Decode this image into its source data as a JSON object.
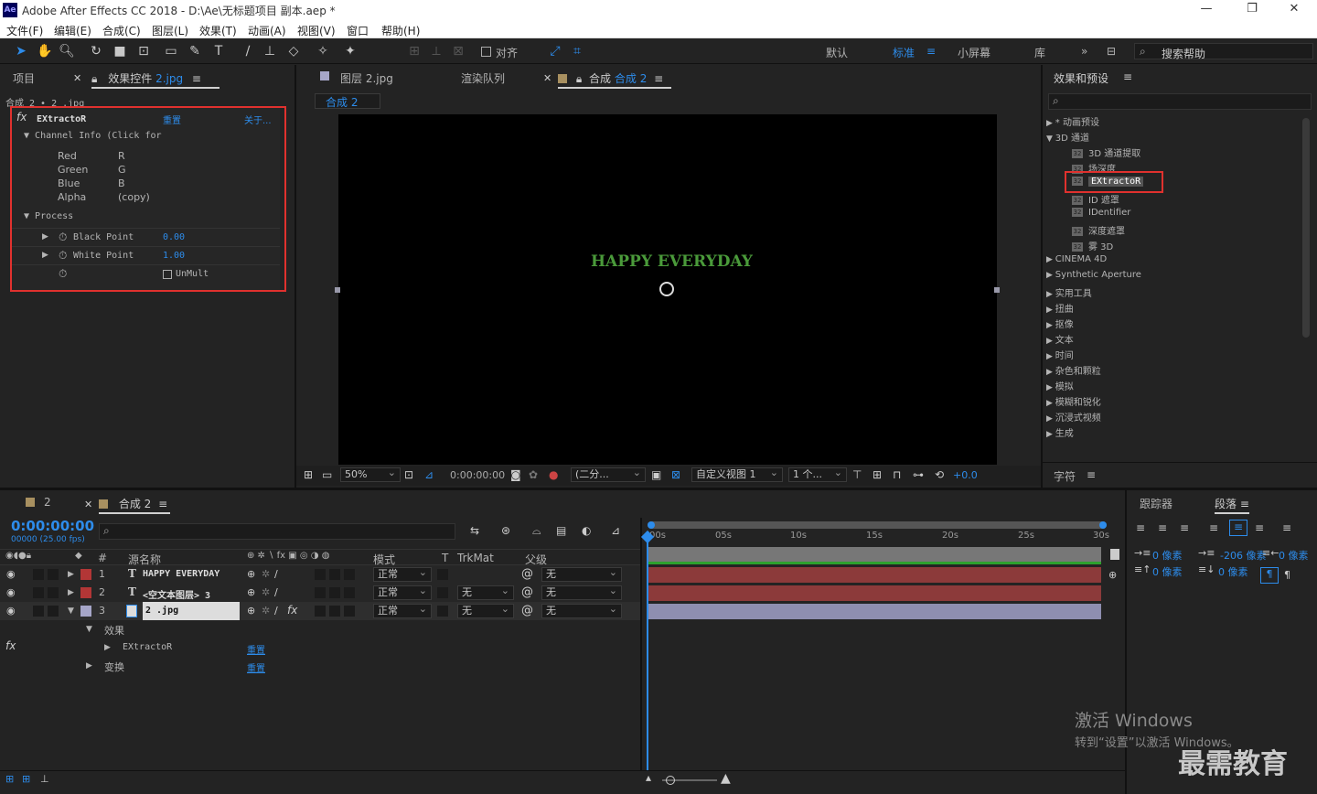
{
  "app": {
    "logo": "Ae",
    "title": "Adobe After Effects CC 2018 - D:\\Ae\\无标题项目 副本.aep *"
  },
  "menu": [
    "文件(F)",
    "编辑(E)",
    "合成(C)",
    "图层(L)",
    "效果(T)",
    "动画(A)",
    "视图(V)",
    "窗口",
    "帮助(H)"
  ],
  "toolbar": {
    "snap_label": "对齐",
    "workspaces": [
      "默认",
      "标准",
      "小屏幕",
      "库"
    ],
    "active_workspace": "标准",
    "search_placeholder": "搜索帮助"
  },
  "left_panel": {
    "tab_project": "项目",
    "tab_effects_prefix": "效果控件",
    "tab_effects_layer": "2.jpg",
    "breadcrumb": "合成 2 • 2 .jpg",
    "effect": {
      "name": "EXtractoR",
      "reset": "重置",
      "about": "关于...",
      "channel_info_label": "Channel Info (Click for",
      "channels": [
        {
          "label": "Red",
          "value": "R"
        },
        {
          "label": "Green",
          "value": "G"
        },
        {
          "label": "Blue",
          "value": "B"
        },
        {
          "label": "Alpha",
          "value": "(copy)"
        }
      ],
      "process_label": "Process",
      "black_point_label": "Black Point",
      "black_point_value": "0.00",
      "white_point_label": "White Point",
      "white_point_value": "1.00",
      "unmult_label": "UnMult"
    }
  },
  "viewer": {
    "tab_layer": "图层 2.jpg",
    "tab_render": "渲染队列",
    "tab_comp_prefix": "合成",
    "tab_comp_name": "合成 2",
    "comp_tag": "合成 2",
    "canvas_text": "HAPPY EVERYDAY",
    "zoom": "50%",
    "timecode": "0:00:00:00",
    "resolution": "(二分...",
    "view": "自定义视图 1",
    "views_count": "1 个...",
    "exposure": "+0.0"
  },
  "effects_presets": {
    "title": "效果和预设",
    "search_placeholder": "",
    "items": [
      {
        "label": "* 动画预设",
        "level": 0,
        "arrow": "▶"
      },
      {
        "label": "3D 通道",
        "level": 0,
        "arrow": "▼"
      },
      {
        "label": "3D 通道提取",
        "level": 1
      },
      {
        "label": "场深度",
        "level": 1
      },
      {
        "label": "EXtractoR",
        "level": 1,
        "selected": true
      },
      {
        "label": "ID 遮罩",
        "level": 1
      },
      {
        "label": "IDentifier",
        "level": 1
      },
      {
        "label": "深度遮罩",
        "level": 1
      },
      {
        "label": "雾 3D",
        "level": 1
      },
      {
        "label": "CINEMA 4D",
        "level": 0,
        "arrow": "▶"
      },
      {
        "label": "Synthetic Aperture",
        "level": 0,
        "arrow": "▶"
      },
      {
        "label": "实用工具",
        "level": 0,
        "arrow": "▶"
      },
      {
        "label": "扭曲",
        "level": 0,
        "arrow": "▶"
      },
      {
        "label": "抠像",
        "level": 0,
        "arrow": "▶"
      },
      {
        "label": "文本",
        "level": 0,
        "arrow": "▶"
      },
      {
        "label": "时间",
        "level": 0,
        "arrow": "▶"
      },
      {
        "label": "杂色和颗粒",
        "level": 0,
        "arrow": "▶"
      },
      {
        "label": "模拟",
        "level": 0,
        "arrow": "▶"
      },
      {
        "label": "模糊和锐化",
        "level": 0,
        "arrow": "▶"
      },
      {
        "label": "沉浸式视频",
        "level": 0,
        "arrow": "▶"
      },
      {
        "label": "生成",
        "level": 0,
        "arrow": "▶"
      }
    ],
    "character_tab": "字符"
  },
  "timeline": {
    "tab_1": "2",
    "tab_2": "合成 2",
    "timecode": "0:00:00:00",
    "fps": "00000 (25.00 fps)",
    "headers": {
      "num": "#",
      "source": "源名称",
      "mode": "模式",
      "t": "T",
      "trkmat": "TrkMat",
      "parent": "父级"
    },
    "layers": [
      {
        "num": "1",
        "type": "T",
        "name": "HAPPY EVERYDAY",
        "mode": "正常",
        "trkmat": "",
        "parent": "无",
        "color": "#b33636"
      },
      {
        "num": "2",
        "type": "T",
        "name": "<空文本图层> 3",
        "mode": "正常",
        "trkmat": "无",
        "parent": "无",
        "color": "#b33636"
      },
      {
        "num": "3",
        "type": "img",
        "name": "2 .jpg",
        "mode": "正常",
        "trkmat": "无",
        "parent": "无",
        "color": "#a6a6c8"
      }
    ],
    "sub_effects": "效果",
    "sub_extractor": "EXtractoR",
    "sub_transform": "变换",
    "reset": "重置",
    "ruler": [
      "00s",
      "05s",
      "10s",
      "15s",
      "20s",
      "25s",
      "30s"
    ]
  },
  "right_bottom": {
    "tab_tracker": "跟踪器",
    "tab_paragraph": "段落",
    "indent_left": "0 像素",
    "indent_first": "-206 像素",
    "indent_right": "0 像素",
    "space_before": "0 像素",
    "space_after": "0 像素"
  },
  "watermark": {
    "line1": "激活 Windows",
    "line2": "转到“设置”以激活 Windows。",
    "brand": "最需教育"
  }
}
